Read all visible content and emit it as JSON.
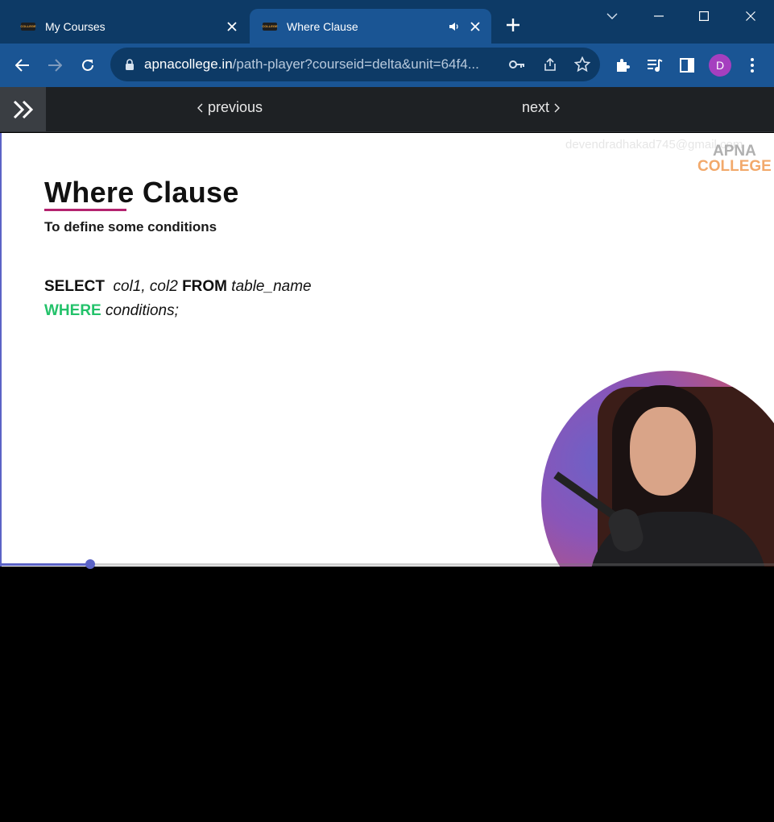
{
  "tabs": [
    {
      "title": "My Courses",
      "favicon_text": "COLLEGE",
      "active": false
    },
    {
      "title": "Where Clause",
      "favicon_text": "COLLEGE",
      "active": true
    }
  ],
  "address_bar": {
    "domain": "apnacollege.in",
    "path": "/path-player?courseid=delta&unit=64f4..."
  },
  "profile": {
    "initial": "D",
    "color": "#a53fbf"
  },
  "player_nav": {
    "previous_label": "previous",
    "next_label": "next"
  },
  "slide": {
    "title": "Where Clause",
    "subtitle": "To define some conditions",
    "code": {
      "line1": {
        "kw1": "SELECT",
        "cols": "col1, col2",
        "kw2": "FROM",
        "table": "table_name"
      },
      "line2": {
        "kw": "WHERE",
        "rest": "conditions;"
      }
    },
    "watermark": "devendradhakad745@gmail.com",
    "logo": {
      "line1": "APNA",
      "line2": "COLLEGE"
    }
  },
  "progress": {
    "fraction": 0.115
  },
  "colors": {
    "accent": "#5b63c6",
    "where_keyword": "#23c26a",
    "underline": "#b4236f"
  }
}
